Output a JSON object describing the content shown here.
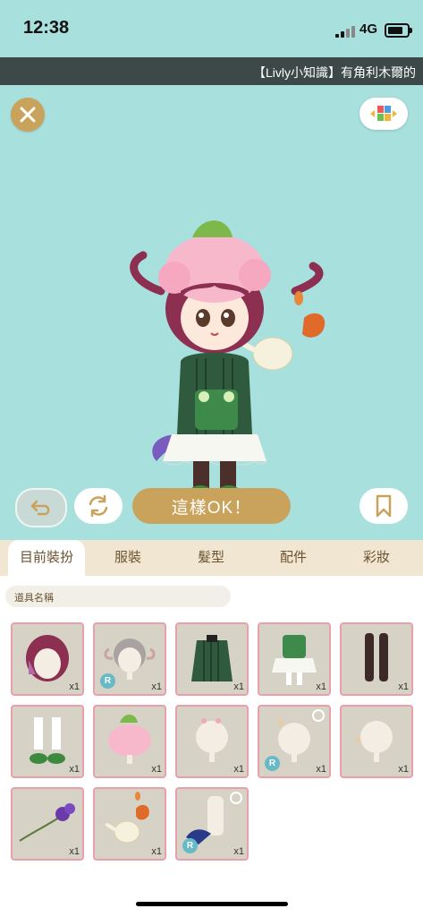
{
  "status_bar": {
    "time": "12:38",
    "network": "4G"
  },
  "ticker": {
    "text": "【Livly小知識】有角利木爾的"
  },
  "actions": {
    "confirm_label": "這樣OK！"
  },
  "tabs": [
    {
      "label": "目前裝扮",
      "active": true
    },
    {
      "label": "服裝",
      "active": false
    },
    {
      "label": "髮型",
      "active": false
    },
    {
      "label": "配件",
      "active": false
    },
    {
      "label": "彩妝",
      "active": false
    }
  ],
  "search": {
    "placeholder": "道具名稱"
  },
  "items": [
    {
      "icon": "purple-hair-icon",
      "qty": "x1",
      "rare": false
    },
    {
      "icon": "gray-hair-icon",
      "qty": "x1",
      "rare": true
    },
    {
      "icon": "striped-jacket-icon",
      "qty": "x1",
      "rare": false
    },
    {
      "icon": "green-frill-dress-icon",
      "qty": "x1",
      "rare": false
    },
    {
      "icon": "brown-socks-icon",
      "qty": "x1",
      "rare": false
    },
    {
      "icon": "green-shoes-icon",
      "qty": "x1",
      "rare": false
    },
    {
      "icon": "pink-flower-hat-icon",
      "qty": "x1",
      "rare": false
    },
    {
      "icon": "head-ornament-icon",
      "qty": "x1",
      "rare": false
    },
    {
      "icon": "horned-head-icon",
      "qty": "x1",
      "rare": true
    },
    {
      "icon": "plain-head-icon",
      "qty": "x1",
      "rare": false
    },
    {
      "icon": "violet-flower-icon",
      "qty": "x1",
      "rare": false
    },
    {
      "icon": "teapot-icon",
      "qty": "x1",
      "rare": false
    },
    {
      "icon": "tail-icon",
      "qty": "x1",
      "rare": true
    }
  ],
  "colors": {
    "accent": "#c9a35c",
    "stage": "#a8e0de",
    "ticker": "#3d4948",
    "tab_bar": "#f1e6d2",
    "cell_border": "#e9a0ab"
  }
}
